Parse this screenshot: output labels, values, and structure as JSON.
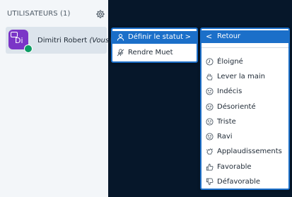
{
  "sidebar": {
    "users_title": "UTILISATEURS (1)",
    "user": {
      "initials": "Di",
      "name": "Dimitri Robert",
      "suffix": "(Vous)"
    }
  },
  "menu1": {
    "items": [
      {
        "label": "Définir le statut",
        "icon": "person-icon",
        "selected": true
      },
      {
        "label": "Rendre Muet",
        "icon": "microphone-muted-icon"
      }
    ]
  },
  "menu2": {
    "back_label": "Retour",
    "items": [
      {
        "label": "Éloigné",
        "icon": "clock-icon"
      },
      {
        "label": "Lever la main",
        "icon": "raise-hand-icon"
      },
      {
        "label": "Indécis",
        "icon": "neutral-face-icon"
      },
      {
        "label": "Désorienté",
        "icon": "confused-face-icon"
      },
      {
        "label": "Triste",
        "icon": "sad-face-icon"
      },
      {
        "label": "Ravi",
        "icon": "happy-face-icon"
      },
      {
        "label": "Applaudissements",
        "icon": "applause-icon"
      },
      {
        "label": "Favorable",
        "icon": "thumbs-up-icon"
      },
      {
        "label": "Défavorable",
        "icon": "thumbs-down-icon"
      }
    ]
  },
  "colors": {
    "accent": "#1B6FC9",
    "avatar": "#7B35C7",
    "background": "#06172A",
    "badge": "#0D9C64"
  }
}
